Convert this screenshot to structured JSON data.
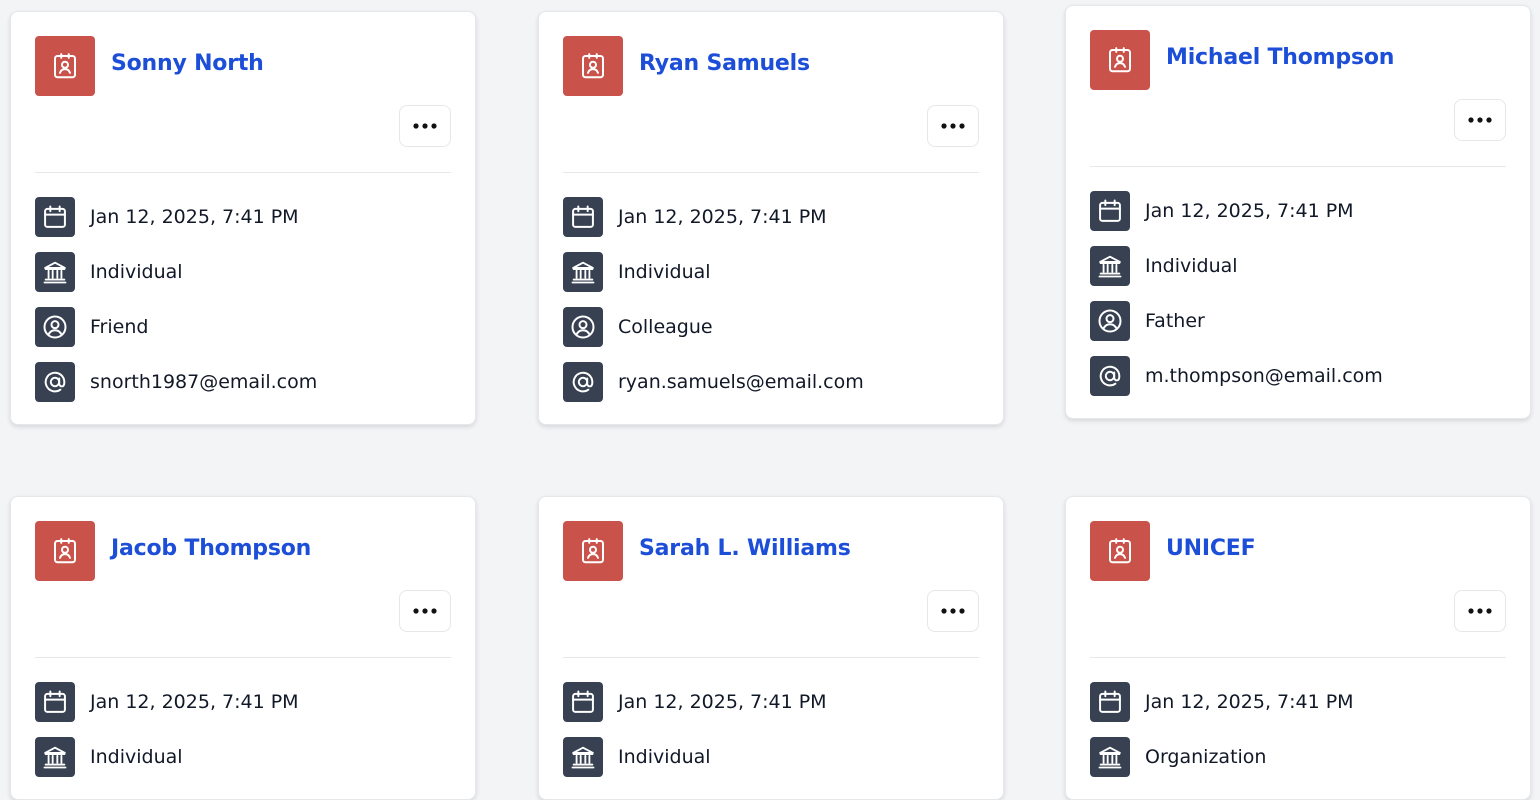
{
  "colors": {
    "background": "#f3f4f6",
    "avatar": "#c9534a",
    "name_link": "#1d4ed8",
    "icon_tile": "#374151"
  },
  "cards": [
    {
      "name": "Sonny North",
      "avatar_icon": "contact-badge-icon",
      "more_label": "•••",
      "details": {
        "date": "Jan 12, 2025, 7:41 PM",
        "type": "Individual",
        "relationship": "Friend",
        "email": "snorth1987@email.com"
      }
    },
    {
      "name": "Ryan Samuels",
      "avatar_icon": "contact-badge-icon",
      "more_label": "•••",
      "details": {
        "date": "Jan 12, 2025, 7:41 PM",
        "type": "Individual",
        "relationship": "Colleague",
        "email": "ryan.samuels@email.com"
      }
    },
    {
      "name": "Michael Thompson",
      "avatar_icon": "contact-badge-icon",
      "more_label": "•••",
      "details": {
        "date": "Jan 12, 2025, 7:41 PM",
        "type": "Individual",
        "relationship": "Father",
        "email": "m.thompson@email.com"
      }
    },
    {
      "name": "Jacob Thompson",
      "avatar_icon": "contact-badge-icon",
      "more_label": "•••",
      "details": {
        "date": "Jan 12, 2025, 7:41 PM",
        "type": "Individual"
      }
    },
    {
      "name": "Sarah L. Williams",
      "avatar_icon": "contact-badge-icon",
      "more_label": "•••",
      "details": {
        "date": "Jan 12, 2025, 7:41 PM",
        "type": "Individual"
      }
    },
    {
      "name": "UNICEF",
      "avatar_icon": "contact-badge-icon",
      "more_label": "•••",
      "details": {
        "date": "Jan 12, 2025, 7:41 PM",
        "type": "Organization"
      }
    }
  ],
  "icons": {
    "date": "calendar-icon",
    "type": "institution-icon",
    "relationship": "user-circle-icon",
    "email": "at-sign-icon"
  }
}
